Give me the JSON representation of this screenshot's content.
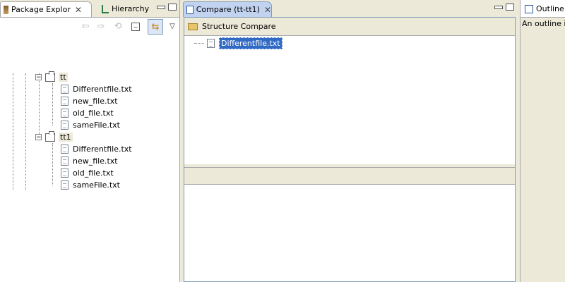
{
  "left_view": {
    "tabs": [
      {
        "label": "Package Explor",
        "icon": "package-explorer-icon",
        "active": true
      },
      {
        "label": "Hierarchy",
        "icon": "hierarchy-icon",
        "active": false
      }
    ],
    "toolbar": [
      "back-icon",
      "forward-icon",
      "up-icon",
      "collapse-all-icon",
      "link-with-editor-icon",
      "view-menu-icon"
    ],
    "tree": [
      {
        "label": "tt",
        "type": "package",
        "expanded": true,
        "children": [
          "Differentfile.txt",
          "new_file.txt",
          "old_file.txt",
          "sameFile.txt"
        ]
      },
      {
        "label": "tt1",
        "type": "package",
        "expanded": true,
        "children": [
          "Differentfile.txt",
          "new_file.txt",
          "old_file.txt",
          "sameFile.txt"
        ]
      }
    ]
  },
  "editor": {
    "tab": {
      "label": "Compare (tt-tt1)",
      "icon": "compare-icon"
    },
    "structure_header": "Structure Compare",
    "structure_items": [
      {
        "label": "Differentfile.txt",
        "selected": true
      }
    ]
  },
  "outline": {
    "tab": {
      "label": "Outline",
      "icon": "outline-icon"
    },
    "message": "An outline is"
  },
  "colors": {
    "selection": "#316ac5",
    "active_tab": "#c1d3f1",
    "chrome": "#ece9d8"
  }
}
